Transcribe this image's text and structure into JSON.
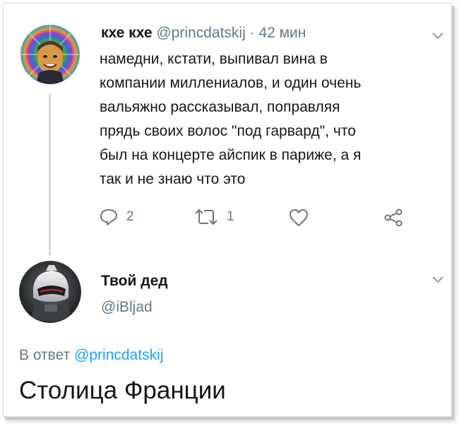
{
  "tweet1": {
    "name": "кхе кхе",
    "handle": "@princdatskij",
    "separator": "·",
    "time": "42 мин",
    "text_lines": [
      "намедни, кстати, выпивал вина в",
      "компании миллениалов, и один очень",
      "вальяжно рассказывал, поправляя",
      "прядь своих волос \"под гарвард\", что",
      "был на концерте айспик в париже, а я",
      "так и не знаю что это"
    ],
    "actions": {
      "reply_count": "2",
      "retweet_count": "1",
      "like_icon": "heart-icon",
      "share_icon": "share-icon"
    }
  },
  "tweet2": {
    "name": "Твой дед",
    "handle": "@iBljad",
    "reply_prefix": "В ответ",
    "reply_handle": "@princdatskij",
    "text": "Столица Франции"
  },
  "colors": {
    "text": "#14171a",
    "muted": "#657786",
    "link": "#1da1f2",
    "thread_line": "#cfd9de"
  }
}
